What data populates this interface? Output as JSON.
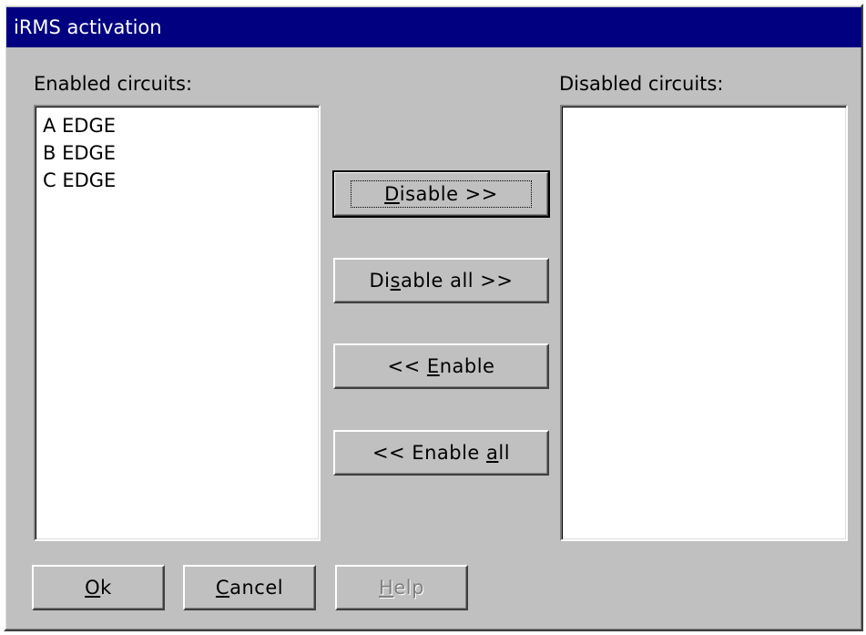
{
  "window": {
    "title": "iRMS activation"
  },
  "enabled": {
    "label": "Enabled circuits:",
    "items": [
      "A EDGE",
      "B EDGE",
      "C EDGE"
    ]
  },
  "disabled": {
    "label": "Disabled circuits:",
    "items": []
  },
  "buttons": {
    "disable": {
      "pre": "",
      "key": "D",
      "post": "isable >>"
    },
    "disable_all": {
      "pre": "Di",
      "key": "s",
      "post": "able all >>"
    },
    "enable": {
      "pre": "<< ",
      "key": "E",
      "post": "nable"
    },
    "enable_all": {
      "pre": "<< Enable ",
      "key": "a",
      "post": "ll"
    },
    "ok": {
      "pre": "",
      "key": "O",
      "post": "k"
    },
    "cancel": {
      "pre": "",
      "key": "C",
      "post": "ancel"
    },
    "help": {
      "pre": "",
      "key": "H",
      "post": "elp"
    }
  }
}
